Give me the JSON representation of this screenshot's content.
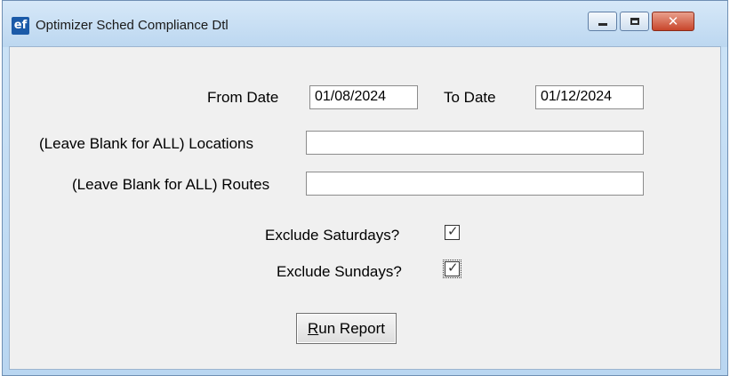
{
  "window": {
    "title": "Optimizer Sched Compliance Dtl",
    "app_icon_text": "ef",
    "close_glyph": "✕"
  },
  "form": {
    "from_date_label": "From Date",
    "from_date_value": "01/08/2024",
    "to_date_label": "To Date",
    "to_date_value": "01/12/2024",
    "locations_label": "(Leave Blank for ALL) Locations",
    "locations_value": "",
    "routes_label": "(Leave Blank for ALL) Routes",
    "routes_value": "",
    "exclude_saturdays_label": "Exclude Saturdays?",
    "exclude_saturdays_checked": true,
    "exclude_sundays_label": "Exclude Sundays?",
    "exclude_sundays_checked": true,
    "run_report_mnemonic": "R",
    "run_report_rest": "un Report",
    "check_glyph": "✓"
  }
}
